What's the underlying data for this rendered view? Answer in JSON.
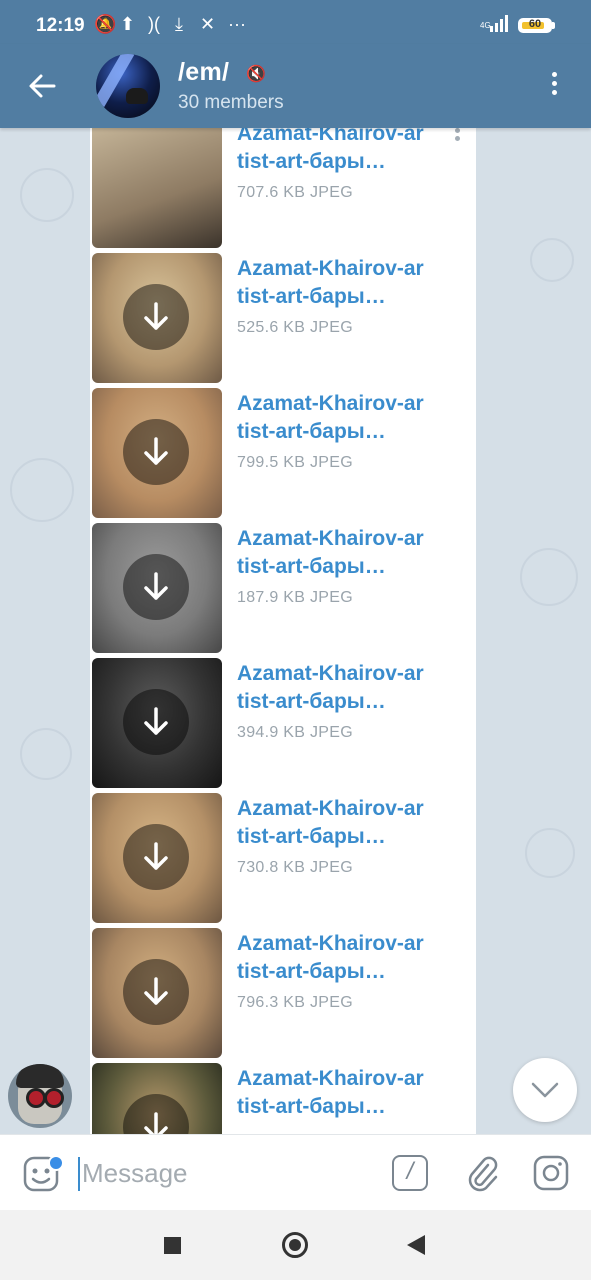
{
  "status_bar": {
    "time": "12:19",
    "network": "4G",
    "battery": "60"
  },
  "header": {
    "title": "/em/",
    "subtitle": "30 members"
  },
  "files": [
    {
      "name": "Azamat-Khairov-ar\ntist-art-бары…",
      "meta": "707.6 KB JPEG",
      "downloaded": true,
      "thumb_colors": [
        "#c9b99c",
        "#8e7b63",
        "#3b332b"
      ]
    },
    {
      "name": "Azamat-Khairov-ar\ntist-art-бары…",
      "meta": "525.6 KB JPEG",
      "downloaded": false,
      "thumb_colors": [
        "#d8c39a",
        "#b49770",
        "#6e5a46"
      ]
    },
    {
      "name": "Azamat-Khairov-ar\ntist-art-бары…",
      "meta": "799.5 KB JPEG",
      "downloaded": false,
      "thumb_colors": [
        "#d2ae82",
        "#b78c62",
        "#7a5e48"
      ]
    },
    {
      "name": "Azamat-Khairov-ar\ntist-art-бары…",
      "meta": "187.9 KB JPEG",
      "downloaded": false,
      "thumb_colors": [
        "#9c9c9c",
        "#7b7b7b",
        "#474747"
      ]
    },
    {
      "name": "Azamat-Khairov-ar\ntist-art-бары…",
      "meta": "394.9 KB JPEG",
      "downloaded": false,
      "thumb_colors": [
        "#5c5c5c",
        "#333333",
        "#161616"
      ]
    },
    {
      "name": "Azamat-Khairov-ar\ntist-art-бары…",
      "meta": "730.8 KB JPEG",
      "downloaded": false,
      "thumb_colors": [
        "#d6b586",
        "#b49067",
        "#6d5742"
      ]
    },
    {
      "name": "Azamat-Khairov-ar\ntist-art-бары…",
      "meta": "796.3 KB JPEG",
      "downloaded": false,
      "thumb_colors": [
        "#d1ae80",
        "#a88662",
        "#5b4a3c"
      ]
    },
    {
      "name": "Azamat-Khairov-ar\ntist-art-бары…",
      "meta": "",
      "downloaded": false,
      "thumb_colors": [
        "#b79a6c",
        "#5c5a3b",
        "#1e2219"
      ]
    }
  ],
  "composer": {
    "placeholder": "Message",
    "command_label": "/"
  },
  "colors": {
    "header_bg": "#517da2",
    "link_blue": "#3a8ccd",
    "chat_bg": "#d5dfe7"
  }
}
